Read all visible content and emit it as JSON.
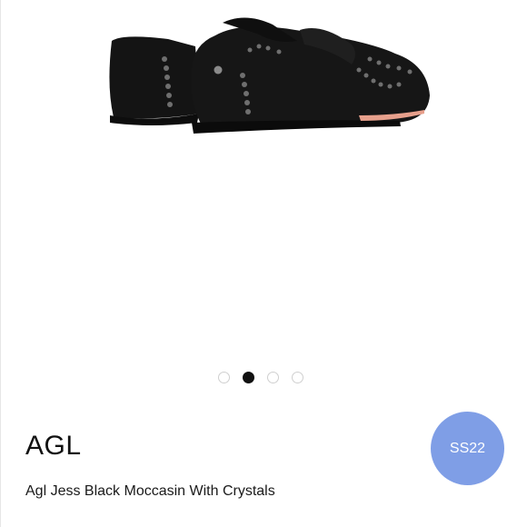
{
  "product": {
    "brand": "AGL",
    "title": "Agl Jess Black Moccasin With Crystals",
    "badge": "SS22",
    "image_alt": "Black studded moccasin loafers, rear view"
  },
  "carousel": {
    "total": 4,
    "active_index": 1
  },
  "colors": {
    "badge": "#7f9ee6",
    "active_dot": "#111111",
    "shoe": "#141414",
    "stud": "#6f6f6f",
    "sole_edge": "#e7a08c"
  }
}
